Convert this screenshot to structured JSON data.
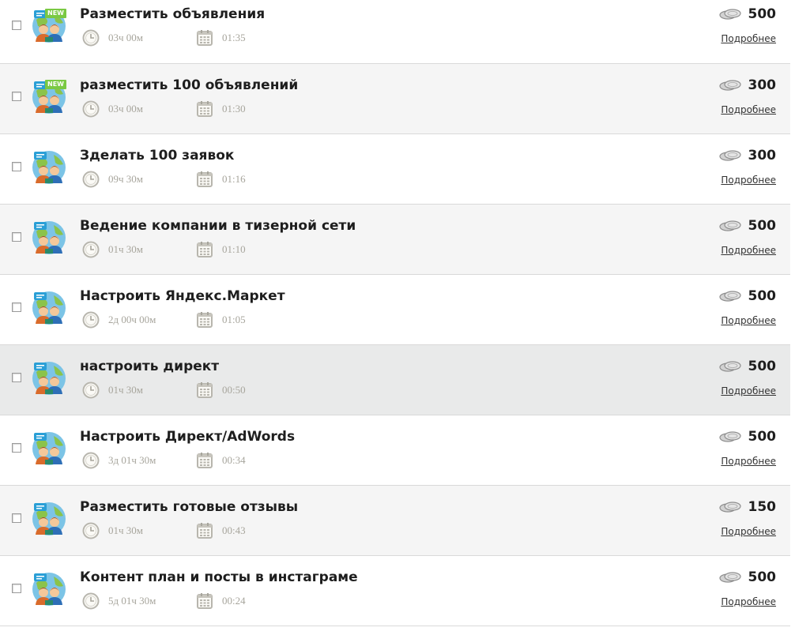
{
  "tasks": [
    {
      "title": "Разместить объявления",
      "is_new": true,
      "new_label": "NEW",
      "duration": "03ч 00м",
      "time": "01:35",
      "price": "500",
      "more_label": "Подробнее"
    },
    {
      "title": "разместить 100 объявлений",
      "is_new": true,
      "new_label": "NEW",
      "duration": "03ч 00м",
      "time": "01:30",
      "price": "300",
      "more_label": "Подробнее"
    },
    {
      "title": "Зделать 100 заявок",
      "is_new": false,
      "duration": "09ч 30м",
      "time": "01:16",
      "price": "300",
      "more_label": "Подробнее"
    },
    {
      "title": "Ведение компании в тизерной сети",
      "is_new": false,
      "duration": "01ч 30м",
      "time": "01:10",
      "price": "500",
      "more_label": "Подробнее"
    },
    {
      "title": "Настроить Яндекс.Маркет",
      "is_new": false,
      "duration": "2д 00ч 00м",
      "time": "01:05",
      "price": "500",
      "more_label": "Подробнее"
    },
    {
      "title": "настроить директ",
      "is_new": false,
      "duration": "01ч 30м",
      "time": "00:50",
      "price": "500",
      "more_label": "Подробнее"
    },
    {
      "title": "Настроить Директ/AdWords",
      "is_new": false,
      "duration": "3д 01ч 30м",
      "time": "00:34",
      "price": "500",
      "more_label": "Подробнее"
    },
    {
      "title": "Разместить готовые отзывы",
      "is_new": false,
      "duration": "01ч 30м",
      "time": "00:43",
      "price": "150",
      "more_label": "Подробнее"
    },
    {
      "title": "Контент план и посты в инстаграме",
      "is_new": false,
      "duration": "5д 01ч 30м",
      "time": "00:24",
      "price": "500",
      "more_label": "Подробнее"
    }
  ],
  "colors": {
    "row_alt": "#f5f5f5",
    "row_highlight": "#e9eaea",
    "new_badge": "#7ac943",
    "meta_text": "#a7a59c"
  },
  "icons": {
    "avatar": "people-globe-avatar-icon",
    "duration": "clock-icon",
    "time": "calendar-icon",
    "price": "coins-icon"
  }
}
